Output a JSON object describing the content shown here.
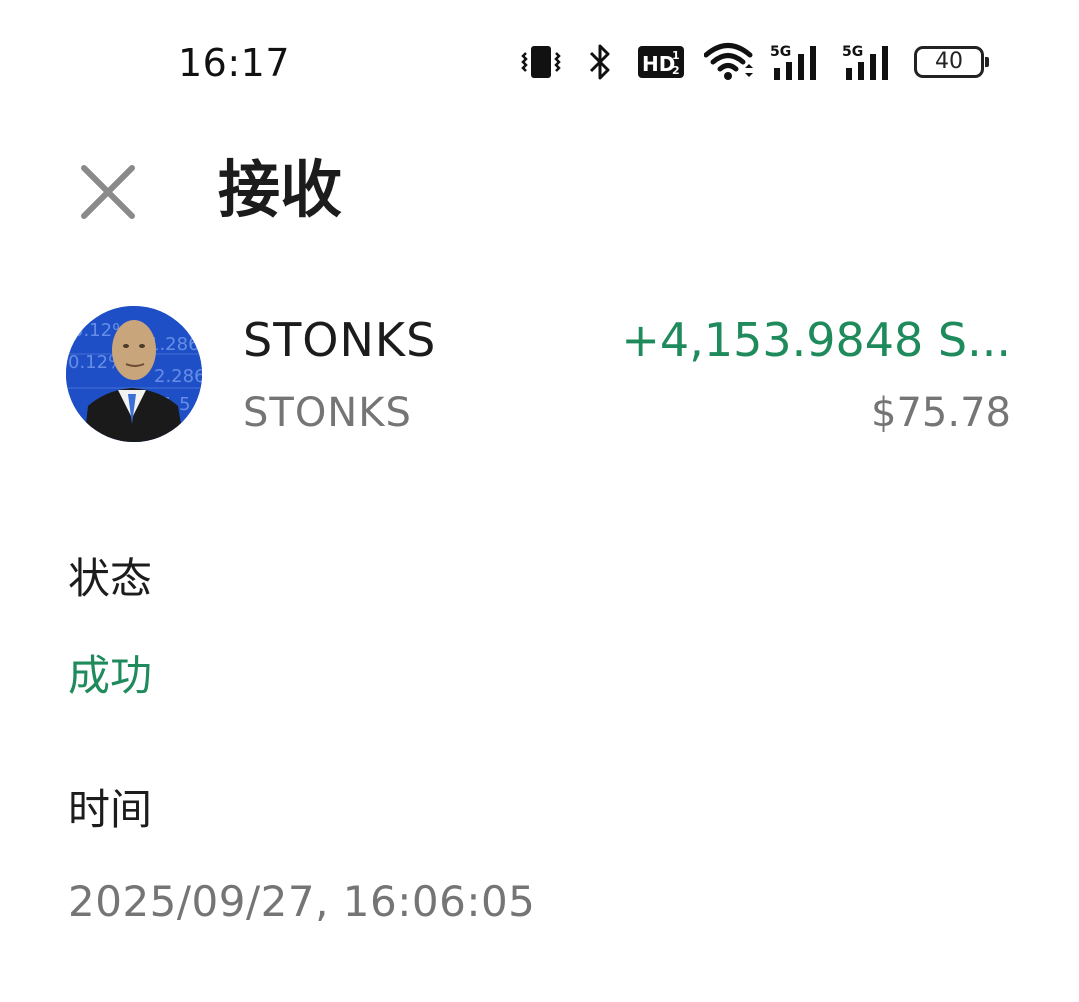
{
  "status_bar": {
    "time": "16:17",
    "battery_level": "40",
    "icons": [
      "vibrate-icon",
      "bluetooth-icon",
      "hd-voice-icon",
      "wifi-icon",
      "5g-signal-icon",
      "5g-signal-icon",
      "battery-icon"
    ]
  },
  "header": {
    "title": "接收",
    "close_icon": "close-icon"
  },
  "token": {
    "name": "STONKS",
    "symbol": "STONKS",
    "amount": "+4,153.9848 S...",
    "usd_value": "$75.78",
    "avatar": "stonks-meme-avatar"
  },
  "details": {
    "status_label": "状态",
    "status_value": "成功",
    "time_label": "时间",
    "time_value": "2025/09/27, 16:06:05"
  },
  "colors": {
    "positive": "#1f8a5b",
    "secondary_text": "#757575",
    "primary_text": "#1c1c1c",
    "icon_gray": "#8a8a8a"
  }
}
